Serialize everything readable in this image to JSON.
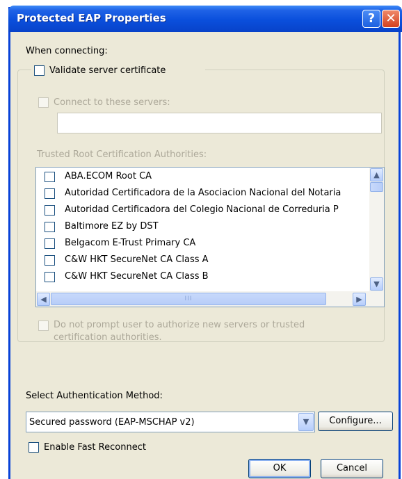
{
  "window": {
    "title": "Protected EAP Properties",
    "help_glyph": "?",
    "close_glyph": "✕"
  },
  "when_connecting_label": "When connecting:",
  "validate_server_certificate": {
    "label": "Validate server certificate",
    "checked": false
  },
  "connect_to_servers": {
    "label": "Connect to these servers:",
    "checked": false,
    "enabled": false,
    "value": ""
  },
  "trusted_root_label": "Trusted Root Certification Authorities:",
  "ca_list": [
    {
      "label": "ABA.ECOM Root CA",
      "checked": false
    },
    {
      "label": "Autoridad Certificadora de la Asociacion Nacional del Notaria",
      "checked": false
    },
    {
      "label": "Autoridad Certificadora del Colegio Nacional de Correduria P",
      "checked": false
    },
    {
      "label": "Baltimore EZ by DST",
      "checked": false
    },
    {
      "label": "Belgacom E-Trust Primary CA",
      "checked": false
    },
    {
      "label": "C&W HKT SecureNet CA Class A",
      "checked": false
    },
    {
      "label": "C&W HKT SecureNet CA Class B",
      "checked": false
    }
  ],
  "scroll": {
    "up": "▲",
    "down": "▼",
    "left": "◀",
    "right": "▶",
    "grip": "III"
  },
  "no_prompt": {
    "line1": "Do not prompt user to authorize new servers or trusted",
    "line2": "certification authorities.",
    "checked": false,
    "enabled": false
  },
  "auth_method_label": "Select Authentication Method:",
  "auth_method": {
    "value": "Secured password (EAP-MSCHAP v2)",
    "arrow": "▼"
  },
  "configure_button": "Configure...",
  "fast_reconnect": {
    "label": "Enable Fast Reconnect",
    "checked": false
  },
  "ok_button": "OK",
  "cancel_button": "Cancel",
  "colors": {
    "titlebar": "#0a4fdc",
    "dialog_bg": "#ece9d8",
    "disabled_text": "#aca899"
  }
}
